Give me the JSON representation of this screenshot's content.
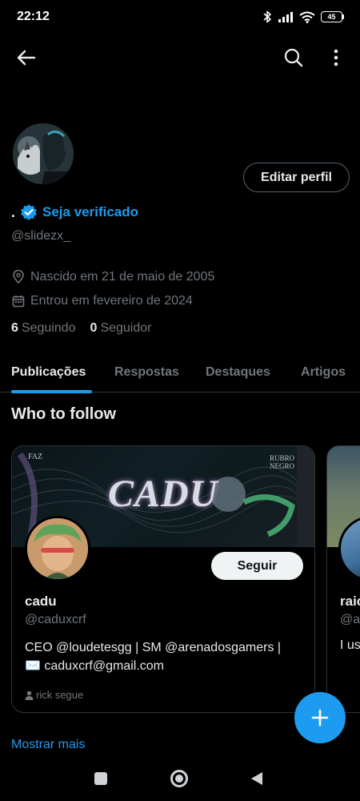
{
  "status_bar": {
    "time": "22:12",
    "battery_level": "45",
    "icons": [
      "bluetooth-icon",
      "signal-icon",
      "wifi-icon",
      "battery-icon"
    ]
  },
  "top_nav": {
    "icons": [
      "back-arrow-icon",
      "search-icon",
      "more-vertical-icon"
    ]
  },
  "profile": {
    "display_name": ".",
    "verify_link": "Seja verificado",
    "handle": "@slidezx_",
    "edit_button": "Editar perfil",
    "birth": "Nascido em 21 de maio de 2005",
    "joined": "Entrou em fevereiro de 2024",
    "following_count": "6",
    "following_label": "Seguindo",
    "followers_count": "0",
    "followers_label": "Seguidor"
  },
  "tabs": [
    {
      "label": "Publicações",
      "active": true
    },
    {
      "label": "Respostas",
      "active": false
    },
    {
      "label": "Destaques",
      "active": false
    },
    {
      "label": "Artigos",
      "active": false
    }
  ],
  "who_to_follow": {
    "title": "Who to follow",
    "cards": [
      {
        "name": "cadu",
        "handle": "@caduxcrf",
        "bio_line1": "CEO @loudetesgg | SM @arenadosgamers |",
        "bio_line2": "✉️ caduxcrf@gmail.com",
        "context": "rick segue",
        "follow_button": "Seguir",
        "banner_text": "CADU",
        "banner_tag_left": "FAZ",
        "banner_tag_right_1": "RUBRO",
        "banner_tag_right_2": "NEGRO"
      },
      {
        "name": "raic",
        "handle": "@a",
        "bio": "I us"
      }
    ],
    "show_more": "Mostrar mais"
  },
  "colors": {
    "background": "#000000",
    "accent": "#1d9bf0",
    "text_primary": "#e7e9ea",
    "text_secondary": "#71767b",
    "border": "#2f3336"
  },
  "fab_icon": "plus-icon",
  "android_nav": [
    "recents-square-icon",
    "home-circle-icon",
    "back-triangle-icon"
  ]
}
